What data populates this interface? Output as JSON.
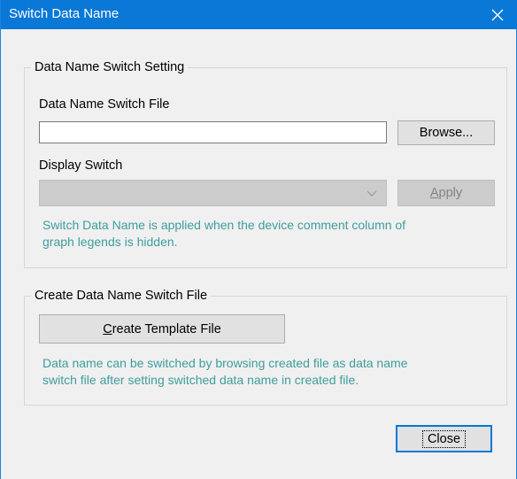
{
  "window": {
    "title": "Switch Data Name"
  },
  "setting_group": {
    "title": "Data Name Switch Setting",
    "file_label": "Data Name Switch File",
    "file_value": "",
    "browse_label": "Browse...",
    "display_switch_label": "Display Switch",
    "display_switch_value": "",
    "apply_label_prefix": "",
    "apply_label_mnemonic": "A",
    "apply_label_rest": "pply",
    "info_line1": "Switch Data Name is applied when the device comment column of",
    "info_line2": "graph legends is hidden."
  },
  "create_group": {
    "title": "Create Data Name Switch File",
    "button_mnemonic": "C",
    "button_rest": "reate Template File",
    "info_line1": "Data name can be switched by browsing created file as data name",
    "info_line2": "switch file after setting switched data name in created file."
  },
  "footer": {
    "close_label": "Close"
  },
  "colors": {
    "titlebar": "#0a78d7",
    "info_text": "#3f9d9d",
    "default_border": "#0078d7"
  },
  "icons": {
    "close": "close-icon",
    "dropdown": "chevron-down-icon"
  }
}
